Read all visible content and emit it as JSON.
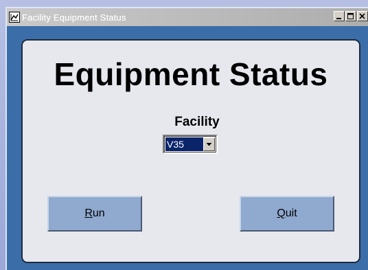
{
  "window": {
    "title": "Facility Equipment Status",
    "caption_buttons": [
      "minimize-icon",
      "maximize-icon",
      "close-icon"
    ]
  },
  "main": {
    "heading": "Equipment Status",
    "facility": {
      "label": "Facility",
      "selected": "V35"
    },
    "buttons": {
      "run": {
        "mnemonic": "R",
        "rest": "un"
      },
      "quit": {
        "mnemonic": "Q",
        "rest": "uit"
      }
    }
  },
  "colors": {
    "window_frame": "#3b6ea8",
    "panel": "#e6e8ee",
    "button": "#8fa9cf",
    "selection": "#0a246a"
  }
}
